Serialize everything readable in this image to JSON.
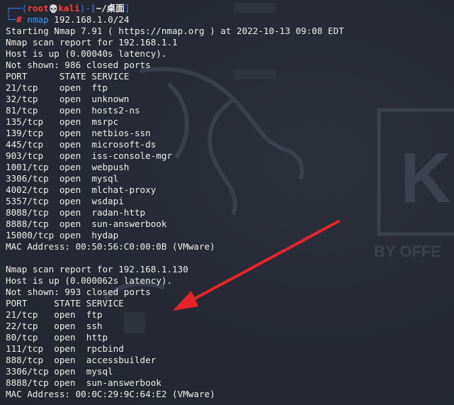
{
  "prompt": {
    "deco_open": "┌──(",
    "user": "root",
    "skull": "💀",
    "host": "kali",
    "deco_mid": ")-[",
    "path": "~/桌面",
    "deco_close": "]",
    "deco_cmd": "└─",
    "hash": "#",
    "command": "nmap",
    "args": " 192.168.1.0/24"
  },
  "output_lines": [
    "Starting Nmap 7.91 ( https://nmap.org ) at 2022-10-13 09:08 EDT",
    "Nmap scan report for 192.168.1.1",
    "Host is up (0.00040s latency).",
    "Not shown: 986 closed ports",
    "PORT      STATE SERVICE",
    "21/tcp    open  ftp",
    "32/tcp    open  unknown",
    "81/tcp    open  hosts2-ns",
    "135/tcp   open  msrpc",
    "139/tcp   open  netbios-ssn",
    "445/tcp   open  microsoft-ds",
    "903/tcp   open  iss-console-mgr",
    "1001/tcp  open  webpush",
    "3306/tcp  open  mysql",
    "4002/tcp  open  mlchat-proxy",
    "5357/tcp  open  wsdapi",
    "8088/tcp  open  radan-http",
    "8888/tcp  open  sun-answerbook",
    "15000/tcp open  hydap",
    "MAC Address: 00:50:56:C0:00:0B (VMware)",
    "",
    "Nmap scan report for 192.168.1.130",
    "Host is up (0.000062s latency).",
    "Not shown: 993 closed ports",
    "PORT     STATE SERVICE",
    "21/tcp   open  ftp",
    "22/tcp   open  ssh",
    "80/tcp   open  http",
    "111/tcp  open  rpcbind",
    "888/tcp  open  accessbuilder",
    "3306/tcp open  mysql",
    "8888/tcp open  sun-answerbook",
    "MAC Address: 00:0C:29:9C:64:E2 (VMware)"
  ],
  "background": {
    "logo_text": "BY OFFE",
    "logo_letter": "K"
  },
  "colors": {
    "terminal_bg": "#262933",
    "text": "#eeeeee",
    "prompt_deco": "#2f7bff",
    "prompt_user": "#ff3b3b",
    "command": "#3d9cff",
    "annotation_arrow": "#e8242a"
  }
}
